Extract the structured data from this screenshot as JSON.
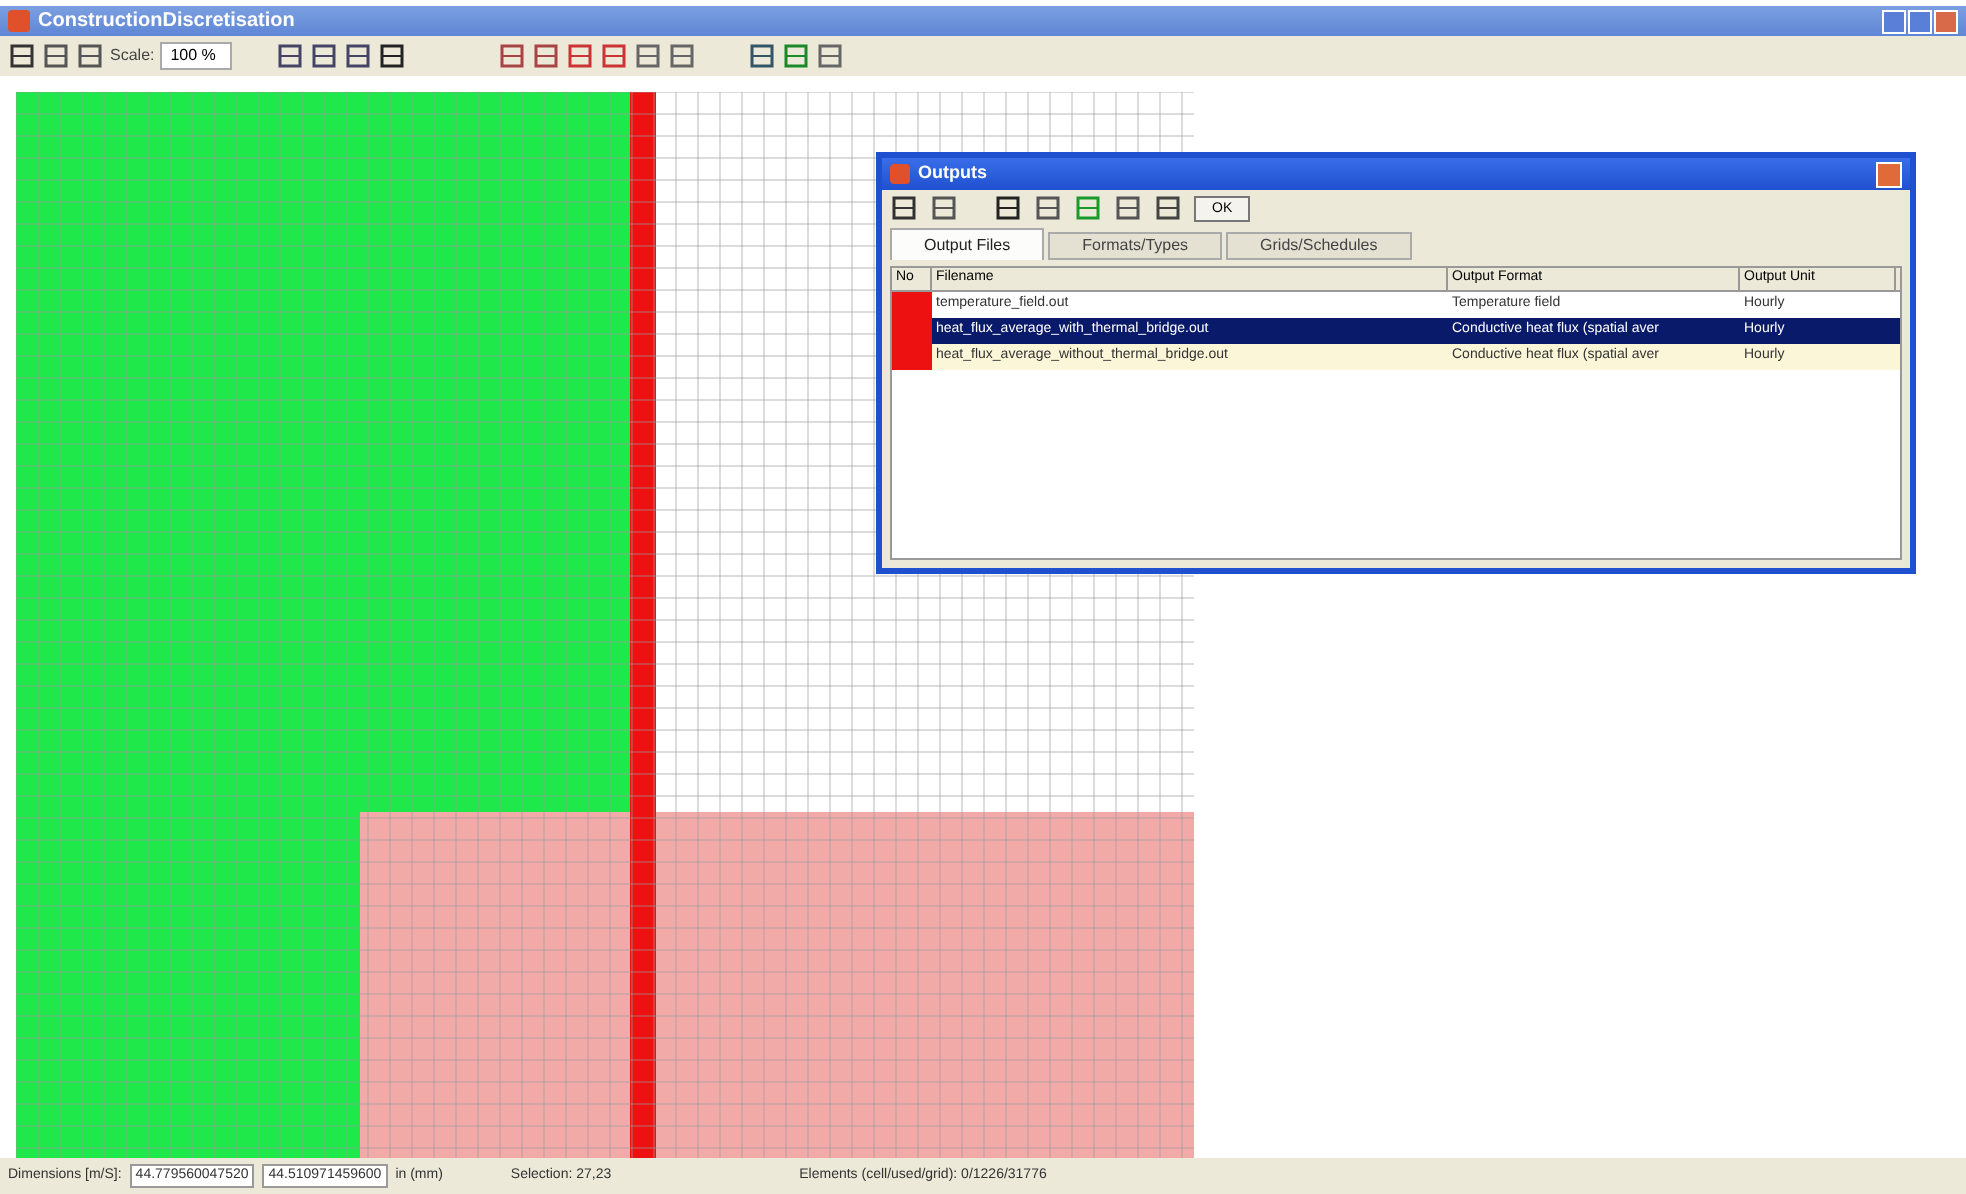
{
  "window": {
    "title": "ConstructionDiscretisation"
  },
  "toolbar": {
    "scale_label": "Scale:",
    "scale_value": "100 %"
  },
  "dialog": {
    "title": "Outputs",
    "ok_button": "OK",
    "tabs": [
      {
        "label": "Output Files",
        "selected": true
      },
      {
        "label": "Formats/Types",
        "selected": false
      },
      {
        "label": "Grids/Schedules",
        "selected": false
      }
    ],
    "table": {
      "columns": [
        "No",
        "Filename",
        "Output Format",
        "Output Unit"
      ],
      "rows": [
        {
          "color": "#ee1111",
          "filename": "temperature_field.out",
          "format": "Temperature field",
          "unit": "Hourly",
          "selected": false
        },
        {
          "color": "#ee1111",
          "filename": "heat_flux_average_with_thermal_bridge.out",
          "format": "Conductive heat flux (spatial aver",
          "unit": "Hourly",
          "selected": true
        },
        {
          "color": "#ee1111",
          "filename": "heat_flux_average_without_thermal_bridge.out",
          "format": "Conductive heat flux (spatial aver",
          "unit": "Hourly",
          "selected": false
        }
      ]
    }
  },
  "status_bar": {
    "label": "Dimensions [m/S]:",
    "x_value": "44.779560047520",
    "y_value": "44.510971459600",
    "unit": "in (mm)",
    "selection": "Selection: 27,23",
    "elements": "Elements (cell/used/grid): 0/1226/31776"
  }
}
